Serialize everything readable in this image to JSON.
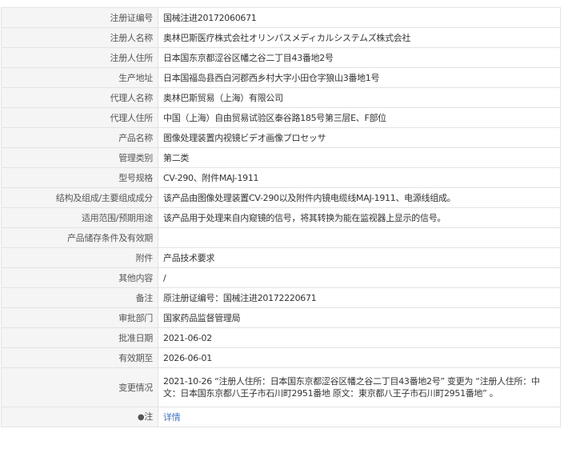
{
  "rows": [
    {
      "label": "注册证编号",
      "value": "国械注进20172060671"
    },
    {
      "label": "注册人名称",
      "value": "奥林巴斯医疗株式会社オリンパスメディカルシステムズ株式会社"
    },
    {
      "label": "注册人住所",
      "value": "日本国东京都涩谷区幡之谷二丁目43番地2号"
    },
    {
      "label": "生产地址",
      "value": "日本国福岛县西白河郡西乡村大字小田仓字狼山3番地1号"
    },
    {
      "label": "代理人名称",
      "value": "奥林巴斯贸易（上海）有限公司"
    },
    {
      "label": "代理人住所",
      "value": "中国（上海）自由贸易试验区泰谷路185号第三层E、F部位"
    },
    {
      "label": "产品名称",
      "value": "图像处理装置内视镜ビデオ画像プロセッサ"
    },
    {
      "label": "管理类别",
      "value": "第二类"
    },
    {
      "label": "型号规格",
      "value": "CV-290、附件MAJ-1911"
    },
    {
      "label": "结构及组成/主要组成成分",
      "value": "该产品由图像处理装置CV-290以及附件内镜电缆线MAJ-1911、电源线组成。"
    },
    {
      "label": "适用范围/预期用途",
      "value": "该产品用于处理来自内窥镜的信号，将其转换为能在监视器上显示的信号。"
    },
    {
      "label": "产品储存条件及有效期",
      "value": ""
    },
    {
      "label": "附件",
      "value": "产品技术要求"
    },
    {
      "label": "其他内容",
      "value": "/"
    },
    {
      "label": "备注",
      "value": "原注册证编号：国械注进20172220671"
    },
    {
      "label": "审批部门",
      "value": "国家药品监督管理局"
    },
    {
      "label": "批准日期",
      "value": "2021-06-02"
    },
    {
      "label": "有效期至",
      "value": "2026-06-01"
    },
    {
      "label": "变更情况",
      "value": "2021-10-26 “注册人住所：日本国东京都涩谷区幡之谷二丁目43番地2号” 变更为 “注册人住所：中文：日本国东京都八王子市石川町2951番地 原文：東京都八王子市石川町2951番地” 。"
    }
  ],
  "note_row": {
    "label": "注",
    "link": "详情"
  },
  "icons": {
    "pin": "map-pin-icon"
  },
  "colors": {
    "label_bg": "#f5f5f5",
    "border": "#e3e3e3",
    "link": "#3b73c8"
  }
}
